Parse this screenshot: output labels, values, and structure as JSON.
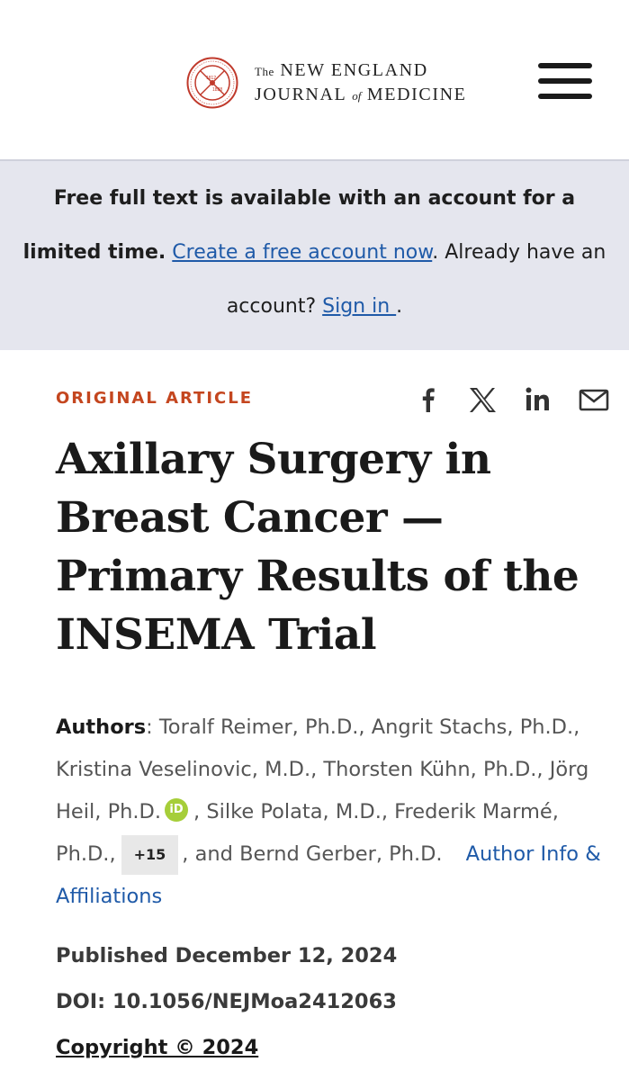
{
  "header": {
    "logo": {
      "the": "The",
      "line1": "NEW ENGLAND",
      "journal": "JOURNAL",
      "of": "of",
      "medicine": "MEDICINE",
      "seal_icon": "nejm-seal-icon"
    },
    "menu_icon": "hamburger-menu-icon"
  },
  "banner": {
    "bold_text": "Free full text is available with an account for a limited time.",
    "create_link": "Create a free account now",
    "middle_text": ". Already have an account? ",
    "signin_link": "Sign in ",
    "end_text": "."
  },
  "article": {
    "type": "ORIGINAL ARTICLE",
    "share": {
      "facebook": "f",
      "x": "X",
      "linkedin": "in",
      "email": "email-icon"
    },
    "title": "Axillary Surgery in Breast Cancer — Primary Results of the INSEMA Trial",
    "authors_label": "Authors",
    "authors_part1": ": Toralf Reimer, Ph.D., Angrit Stachs, Ph.D., Kristina Veselinovic, M.D., Thorsten Kühn, Ph.D., Jörg Heil, Ph.D.",
    "orcid_badge": "iD",
    "authors_part2": ", Silke Polata, M.D., Frederik Marmé, Ph.D.,",
    "more_authors": "+15",
    "authors_part3": ", and Bernd Gerber, Ph.D.",
    "affiliations_link": "Author Info & Affiliations",
    "published": "Published December 12, 2024",
    "doi": "DOI: 10.1056/NEJMoa2412063",
    "copyright": "Copyright © 2024"
  },
  "colors": {
    "accent": "#c4461f",
    "link": "#1f5aa8",
    "banner_bg": "#e5e6ee",
    "orcid": "#a6ce39"
  }
}
